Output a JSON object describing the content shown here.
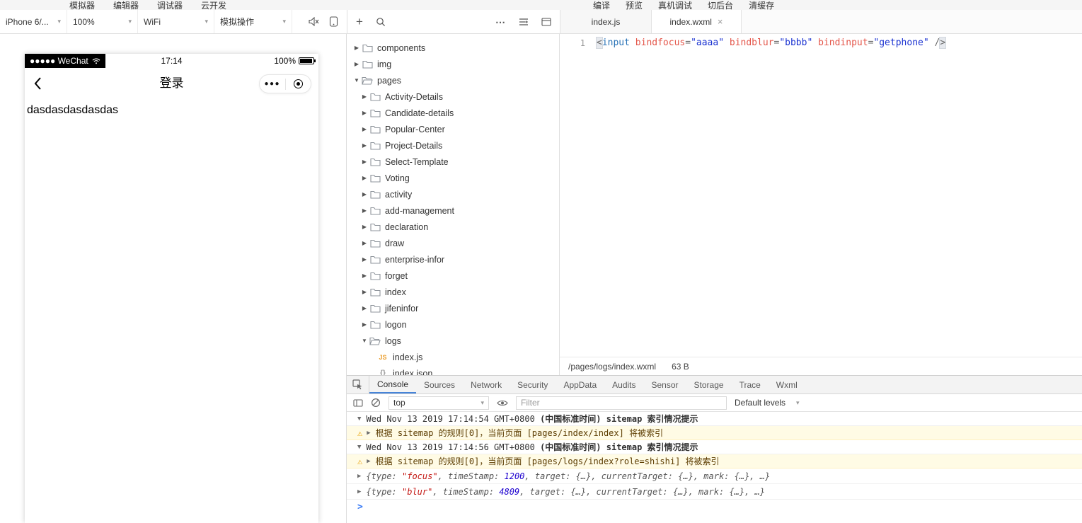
{
  "colors": {
    "accent_blue": "#4684d8",
    "warning_bg": "#fffbe5",
    "warning_text": "#5c3c00",
    "string_red": "#c41a16",
    "number_blue": "#1c00cf",
    "tag_blue": "#2973b7",
    "attr_red": "#e4564a",
    "js_icon_orange": "#eb9f2e"
  },
  "menubar": {
    "left": [
      {
        "name": "simulator",
        "label": "模拟器"
      },
      {
        "name": "editor",
        "label": "编辑器"
      },
      {
        "name": "debugger",
        "label": "调试器"
      },
      {
        "name": "cloud-dev",
        "label": "云开发"
      }
    ],
    "right": [
      {
        "name": "compile",
        "label": "编译"
      },
      {
        "name": "preview",
        "label": "预览"
      },
      {
        "name": "real-device-debug",
        "label": "真机调试"
      },
      {
        "name": "switch-background",
        "label": "切后台"
      },
      {
        "name": "clear-cache",
        "label": "清缓存"
      }
    ]
  },
  "toolbar": {
    "device_select": "iPhone 6/...",
    "zoom_select": "100%",
    "network_select": "WiFi",
    "simulate_select": "模拟操作"
  },
  "file_tabs": [
    {
      "label": "index.js",
      "active": false,
      "closable": false
    },
    {
      "label": "index.wxml",
      "active": true,
      "closable": true
    }
  ],
  "simulator": {
    "carrier": "●●●●● WeChat",
    "time": "17:14",
    "battery_percent": "100%",
    "nav_title": "登录",
    "page_text": "dasdasdasdasdas"
  },
  "file_tree": [
    {
      "label": "components",
      "icon": "folder",
      "depth": 0,
      "state": "collapsed"
    },
    {
      "label": "img",
      "icon": "folder",
      "depth": 0,
      "state": "collapsed"
    },
    {
      "label": "pages",
      "icon": "folder-open",
      "depth": 0,
      "state": "expanded"
    },
    {
      "label": "Activity-Details",
      "icon": "folder",
      "depth": 1,
      "state": "collapsed"
    },
    {
      "label": "Candidate-details",
      "icon": "folder",
      "depth": 1,
      "state": "collapsed"
    },
    {
      "label": "Popular-Center",
      "icon": "folder",
      "depth": 1,
      "state": "collapsed"
    },
    {
      "label": "Project-Details",
      "icon": "folder",
      "depth": 1,
      "state": "collapsed"
    },
    {
      "label": "Select-Template",
      "icon": "folder",
      "depth": 1,
      "state": "collapsed"
    },
    {
      "label": "Voting",
      "icon": "folder",
      "depth": 1,
      "state": "collapsed"
    },
    {
      "label": "activity",
      "icon": "folder",
      "depth": 1,
      "state": "collapsed"
    },
    {
      "label": "add-management",
      "icon": "folder",
      "depth": 1,
      "state": "collapsed"
    },
    {
      "label": "declaration",
      "icon": "folder",
      "depth": 1,
      "state": "collapsed"
    },
    {
      "label": "draw",
      "icon": "folder",
      "depth": 1,
      "state": "collapsed"
    },
    {
      "label": "enterprise-infor",
      "icon": "folder",
      "depth": 1,
      "state": "collapsed"
    },
    {
      "label": "forget",
      "icon": "folder",
      "depth": 1,
      "state": "collapsed"
    },
    {
      "label": "index",
      "icon": "folder",
      "depth": 1,
      "state": "collapsed"
    },
    {
      "label": "jifeninfor",
      "icon": "folder",
      "depth": 1,
      "state": "collapsed"
    },
    {
      "label": "logon",
      "icon": "folder",
      "depth": 1,
      "state": "collapsed"
    },
    {
      "label": "logs",
      "icon": "folder-open",
      "depth": 1,
      "state": "expanded"
    },
    {
      "label": "index.js",
      "icon": "js",
      "depth": 2,
      "state": "leaf"
    },
    {
      "label": "index.json",
      "icon": "json",
      "depth": 2,
      "state": "leaf"
    }
  ],
  "editor": {
    "line_number": "1",
    "tokens": [
      {
        "text": "<",
        "type": "punct",
        "highlight": true
      },
      {
        "text": "input",
        "type": "tag"
      },
      {
        "text": " ",
        "type": "plain"
      },
      {
        "text": "bindfocus",
        "type": "attr"
      },
      {
        "text": "=",
        "type": "punct"
      },
      {
        "text": "\"aaaa\"",
        "type": "value"
      },
      {
        "text": " ",
        "type": "plain"
      },
      {
        "text": "bindblur",
        "type": "attr"
      },
      {
        "text": "=",
        "type": "punct"
      },
      {
        "text": "\"bbbb\"",
        "type": "value"
      },
      {
        "text": " ",
        "type": "plain"
      },
      {
        "text": "bindinput",
        "type": "attr"
      },
      {
        "text": "=",
        "type": "punct"
      },
      {
        "text": "\"getphone\"",
        "type": "value"
      },
      {
        "text": " /",
        "type": "punct"
      },
      {
        "text": ">",
        "type": "punct",
        "highlight": true
      }
    ],
    "status_path": "/pages/logs/index.wxml",
    "status_size": "63 B"
  },
  "debugger": {
    "tabs": [
      {
        "label": "Console",
        "active": true
      },
      {
        "label": "Sources",
        "active": false
      },
      {
        "label": "Network",
        "active": false
      },
      {
        "label": "Security",
        "active": false
      },
      {
        "label": "AppData",
        "active": false
      },
      {
        "label": "Audits",
        "active": false
      },
      {
        "label": "Sensor",
        "active": false
      },
      {
        "label": "Storage",
        "active": false
      },
      {
        "label": "Trace",
        "active": false
      },
      {
        "label": "Wxml",
        "active": false
      }
    ],
    "context_select": "top",
    "filter_placeholder": "Filter",
    "levels_select": "Default levels",
    "prompt": ">",
    "messages": [
      {
        "kind": "group",
        "parts": [
          {
            "text": "Wed Nov 13 2019 17:14:54 GMT+0800 ",
            "bold": false
          },
          {
            "text": "(中国标准时间)",
            "bold": true
          },
          {
            "text": " sitemap 索引情况提示",
            "bold": true
          }
        ]
      },
      {
        "kind": "warning",
        "text": "根据 sitemap 的规则[0]，当前页面 [pages/index/index] 将被索引"
      },
      {
        "kind": "group",
        "parts": [
          {
            "text": "Wed Nov 13 2019 17:14:56 GMT+0800 ",
            "bold": false
          },
          {
            "text": "(中国标准时间)",
            "bold": true
          },
          {
            "text": " sitemap 索引情况提示",
            "bold": true
          }
        ]
      },
      {
        "kind": "warning",
        "text": "根据 sitemap 的规则[0]，当前页面 [pages/logs/index?role=shishi] 将被索引"
      },
      {
        "kind": "object",
        "tokens": [
          {
            "t": "{type: ",
            "c": "plain"
          },
          {
            "t": "\"focus\"",
            "c": "string"
          },
          {
            "t": ", timeStamp: ",
            "c": "plain"
          },
          {
            "t": "1200",
            "c": "number"
          },
          {
            "t": ", target: {…}, currentTarget: {…}, mark: {…}, …}",
            "c": "plain"
          }
        ]
      },
      {
        "kind": "object",
        "tokens": [
          {
            "t": "{type: ",
            "c": "plain"
          },
          {
            "t": "\"blur\"",
            "c": "string"
          },
          {
            "t": ", timeStamp: ",
            "c": "plain"
          },
          {
            "t": "4809",
            "c": "number"
          },
          {
            "t": ", target: {…}, currentTarget: {…}, mark: {…}, …}",
            "c": "plain"
          }
        ]
      }
    ]
  }
}
